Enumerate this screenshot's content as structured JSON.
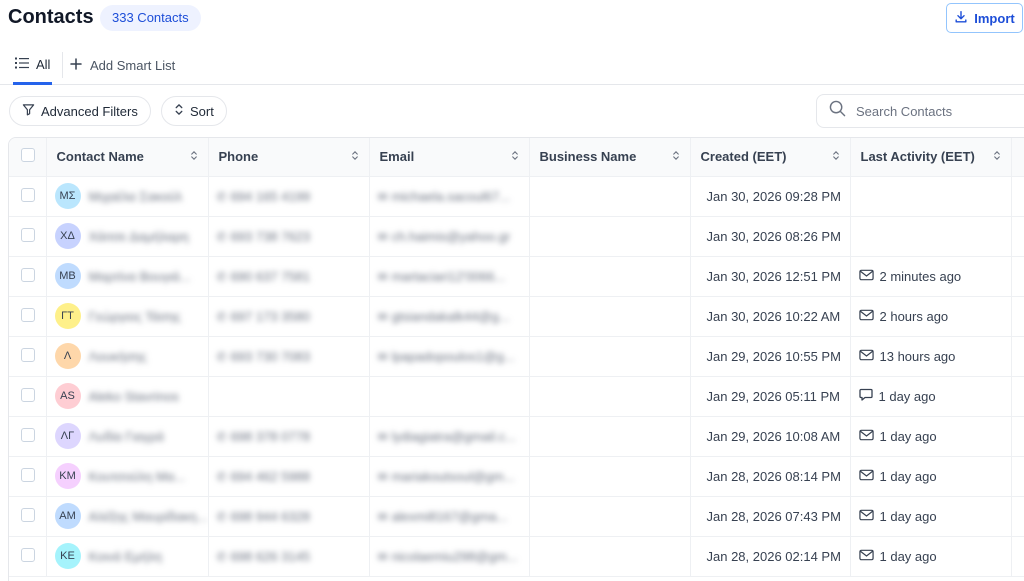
{
  "header": {
    "title": "Contacts",
    "count_badge": "333 Contacts",
    "import_label": "Import"
  },
  "tabs": {
    "all_label": "All",
    "add_smart_list_label": "Add Smart List"
  },
  "toolbar": {
    "advanced_filters_label": "Advanced Filters",
    "sort_label": "Sort",
    "search_placeholder": "Search Contacts"
  },
  "table": {
    "columns": [
      "Contact Name",
      "Phone",
      "Email",
      "Business Name",
      "Created (EET)",
      "Last Activity (EET)"
    ],
    "rows": [
      {
        "initials": "ΜΣ",
        "avatar_color": "#bae6fd",
        "name": "Μιχαέλα Σακούλ",
        "phone": "694 165 4199",
        "email": "michaela.sacoul67...",
        "business": "",
        "created": "Jan 30, 2026 09:28 PM",
        "activity_icon": "",
        "activity": ""
      },
      {
        "initials": "ΧΔ",
        "avatar_color": "#c7d2fe",
        "name": "Χάιτσε Δαμήλαρη",
        "phone": "693 738 7623",
        "email": "ch.haimis@yahoo.gr",
        "business": "",
        "created": "Jan 30, 2026 08:26 PM",
        "activity_icon": "",
        "activity": ""
      },
      {
        "initials": "ΜΒ",
        "avatar_color": "#bfdbfe",
        "name": "Μαρτίνα Βουγιά...",
        "phone": "690 637 7581",
        "email": "martaciari12'0066...",
        "business": "",
        "created": "Jan 30, 2026 12:51 PM",
        "activity_icon": "mail-icon",
        "activity": "2 minutes ago"
      },
      {
        "initials": "ΓΤ",
        "avatar_color": "#fef08a",
        "name": "Γεώργιος Τάσης",
        "phone": "697 173 3580",
        "email": "gtsiandakalk44@g...",
        "business": "",
        "created": "Jan 30, 2026 10:22 AM",
        "activity_icon": "mail-icon",
        "activity": "2 hours ago"
      },
      {
        "initials": "Λ",
        "avatar_color": "#fed7aa",
        "name": "Λουκήσης",
        "phone": "693 730 7083",
        "email": "lpapadopoulos1@g...",
        "business": "",
        "created": "Jan 29, 2026 10:55 PM",
        "activity_icon": "mail-icon",
        "activity": "13 hours ago"
      },
      {
        "initials": "AS",
        "avatar_color": "#fecdd3",
        "name": "Aleko Stavrinos",
        "phone": "",
        "email": "",
        "business": "",
        "created": "Jan 29, 2026 05:11 PM",
        "activity_icon": "chat-icon",
        "activity": "1 day ago"
      },
      {
        "initials": "ΛΓ",
        "avatar_color": "#ddd6fe",
        "name": "Λυδία Γιαγρά",
        "phone": "698 378 0778",
        "email": "lydiagiatra@gmail.c...",
        "business": "",
        "created": "Jan 29, 2026 10:08 AM",
        "activity_icon": "mail-icon",
        "activity": "1 day ago"
      },
      {
        "initials": "ΚΜ",
        "avatar_color": "#f5d0fe",
        "name": "Κουτσούλη Μα...",
        "phone": "694 462 5988",
        "email": "mariakoutsoul@gm...",
        "business": "",
        "created": "Jan 28, 2026 08:14 PM",
        "activity_icon": "mail-icon",
        "activity": "1 day ago"
      },
      {
        "initials": "ΑΜ",
        "avatar_color": "#bfdbfe",
        "name": "Αλέξης Μαυρίδακη...",
        "phone": "698 944 6328",
        "email": "alexmi8167@gma...",
        "business": "",
        "created": "Jan 28, 2026 07:43 PM",
        "activity_icon": "mail-icon",
        "activity": "1 day ago"
      },
      {
        "initials": "ΚΕ",
        "avatar_color": "#a5f3fc",
        "name": "Κοινά Εμήλη",
        "phone": "698 626 3145",
        "email": "nicolaemiu298@gm...",
        "business": "",
        "created": "Jan 28, 2026 02:14 PM",
        "activity_icon": "mail-icon",
        "activity": "1 day ago"
      }
    ]
  }
}
